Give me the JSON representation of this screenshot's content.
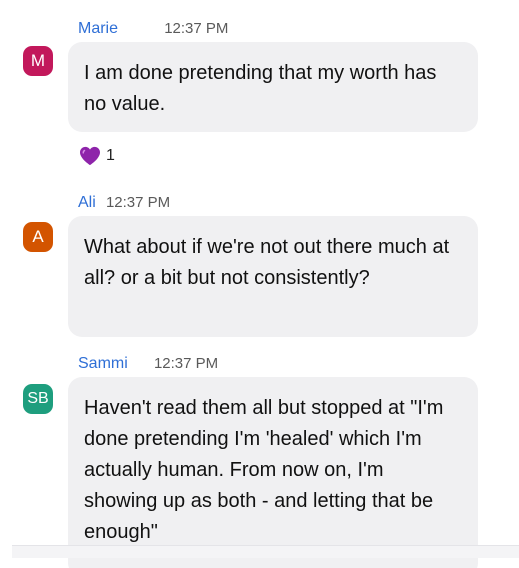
{
  "messages": [
    {
      "avatar_initials": "M",
      "avatar_color": "#c2185b",
      "sender": "Marie",
      "time": "12:37 PM",
      "text": "I am done pretending that my worth has no value.",
      "reaction": {
        "icon": "purple-heart-icon",
        "count": "1"
      }
    },
    {
      "avatar_initials": "A",
      "avatar_color": "#d35400",
      "sender": "Ali",
      "time": "12:37 PM",
      "text": "What about if we're not out there much at all?  or a bit but not consistently?"
    },
    {
      "avatar_initials": "SB",
      "avatar_color": "#1e9e7e",
      "sender": "Sammi",
      "time": "12:37 PM",
      "text": "Haven't read them all but stopped at \"I'm done pretending I'm 'healed' which I'm actually human. From now on, I'm showing up as both - and letting that be enough\""
    }
  ],
  "colors": {
    "sender_name": "#2f6fd6",
    "bubble_bg": "#f0f0f2",
    "heart": "#8e24aa"
  }
}
